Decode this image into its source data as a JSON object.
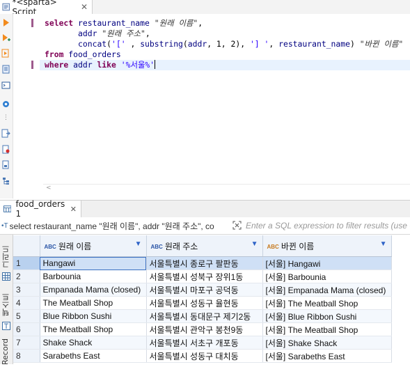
{
  "editor": {
    "tab_title": "*<sparta> Script",
    "tab_close": "✕",
    "scroll_arrow": "<",
    "lines": [
      {
        "parts": [
          [
            "kw",
            "select "
          ],
          [
            "id",
            "restaurant_name "
          ],
          [
            "alias",
            "\"원래 이름\""
          ],
          [
            "",
            ","
          ]
        ]
      },
      {
        "parts": [
          [
            "",
            "       "
          ],
          [
            "id",
            "addr "
          ],
          [
            "alias",
            "\"원래 주소\""
          ],
          [
            "",
            ","
          ]
        ]
      },
      {
        "parts": [
          [
            "",
            "       "
          ],
          [
            "fn",
            "concat"
          ],
          [
            "",
            "("
          ],
          [
            "str",
            "'['"
          ],
          [
            "",
            " , "
          ],
          [
            "fn",
            "substring"
          ],
          [
            "",
            "("
          ],
          [
            "id",
            "addr"
          ],
          [
            "",
            ", 1, 2), "
          ],
          [
            "str",
            "'] '"
          ],
          [
            "",
            ", "
          ],
          [
            "id",
            "restaurant_name"
          ],
          [
            "",
            ") "
          ],
          [
            "alias",
            "\"바뀐 이름\""
          ]
        ]
      },
      {
        "parts": [
          [
            "kw",
            "from "
          ],
          [
            "id",
            "food_orders"
          ]
        ]
      },
      {
        "parts": [
          [
            "kw",
            "where "
          ],
          [
            "id",
            "addr "
          ],
          [
            "kw",
            "like "
          ],
          [
            "str",
            "'%서울%'"
          ]
        ]
      }
    ]
  },
  "results": {
    "tab_label": "food_orders 1",
    "tab_close": "✕",
    "filter_query": "select restaurant_name \"원래 이름\", addr \"원래 주소\", co",
    "filter_placeholder": "Enter a SQL expression to filter results (use C",
    "side_tabs": [
      "그리드",
      "텍스트",
      "Record"
    ],
    "columns": [
      {
        "type": "ABC",
        "label": "원래 이름"
      },
      {
        "type": "ABC",
        "label": "원래 주소"
      },
      {
        "type": "ABC",
        "label": "바뀐 이름"
      }
    ],
    "rows": [
      {
        "n": "1",
        "name": "Hangawi",
        "addr": "서울특별시 종로구 팔판동",
        "new": "[서울] Hangawi"
      },
      {
        "n": "2",
        "name": "Barbounia",
        "addr": "서울특별시 성북구 장위1동",
        "new": "[서울] Barbounia"
      },
      {
        "n": "3",
        "name": "Empanada Mama (closed)",
        "addr": "서울특별시 마포구 공덕동",
        "new": "[서울] Empanada Mama (closed)"
      },
      {
        "n": "4",
        "name": "The Meatball Shop",
        "addr": "서울특별시 성동구 율현동",
        "new": "[서울] The Meatball Shop"
      },
      {
        "n": "5",
        "name": "Blue Ribbon Sushi",
        "addr": "서울특별시 동대문구 제기2동",
        "new": "[서울] Blue Ribbon Sushi"
      },
      {
        "n": "6",
        "name": "The Meatball Shop",
        "addr": "서울특별시 관악구 봉천9동",
        "new": "[서울] The Meatball Shop"
      },
      {
        "n": "7",
        "name": "Shake Shack",
        "addr": "서울특별시 서초구 개포동",
        "new": "[서울] Shake Shack"
      },
      {
        "n": "8",
        "name": "Sarabeths East",
        "addr": "서울특별시 성동구 대치동",
        "new": "[서울] Sarabeths East"
      }
    ]
  }
}
